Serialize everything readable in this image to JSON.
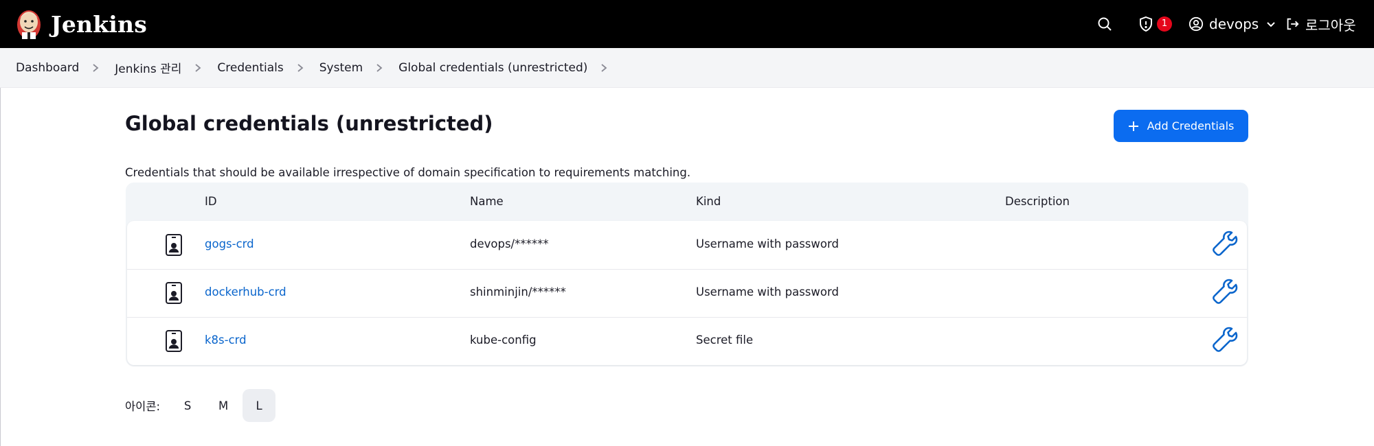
{
  "header": {
    "brand": "Jenkins",
    "security_count": "1",
    "user": "devops",
    "logout": "로그아웃"
  },
  "breadcrumb": [
    "Dashboard",
    "Jenkins 관리",
    "Credentials",
    "System",
    "Global credentials (unrestricted)"
  ],
  "page": {
    "title": "Global credentials (unrestricted)",
    "add_button": "Add Credentials",
    "description": "Credentials that should be available irrespective of domain specification to requirements matching."
  },
  "table": {
    "columns": [
      "ID",
      "Name",
      "Kind",
      "Description"
    ],
    "rows": [
      {
        "id": "gogs-crd",
        "name": "devops/******",
        "kind": "Username with password",
        "description": ""
      },
      {
        "id": "dockerhub-crd",
        "name": "shinminjin/******",
        "kind": "Username with password",
        "description": ""
      },
      {
        "id": "k8s-crd",
        "name": "kube-config",
        "kind": "Secret file",
        "description": ""
      }
    ]
  },
  "icon_size": {
    "label": "아이콘:",
    "options": [
      "S",
      "M",
      "L"
    ],
    "selected": "L"
  },
  "colors": {
    "header_bg": "#000000",
    "accent": "#0b6cf0",
    "link": "#0a65cc",
    "badge": "#e5061b"
  },
  "icons": [
    "jenkins-logo",
    "search-icon",
    "shield-icon",
    "user-circle-icon",
    "chevron-down-icon",
    "logout-icon",
    "chevron-right-icon",
    "plus-icon",
    "credential-card-icon",
    "wrench-icon"
  ]
}
